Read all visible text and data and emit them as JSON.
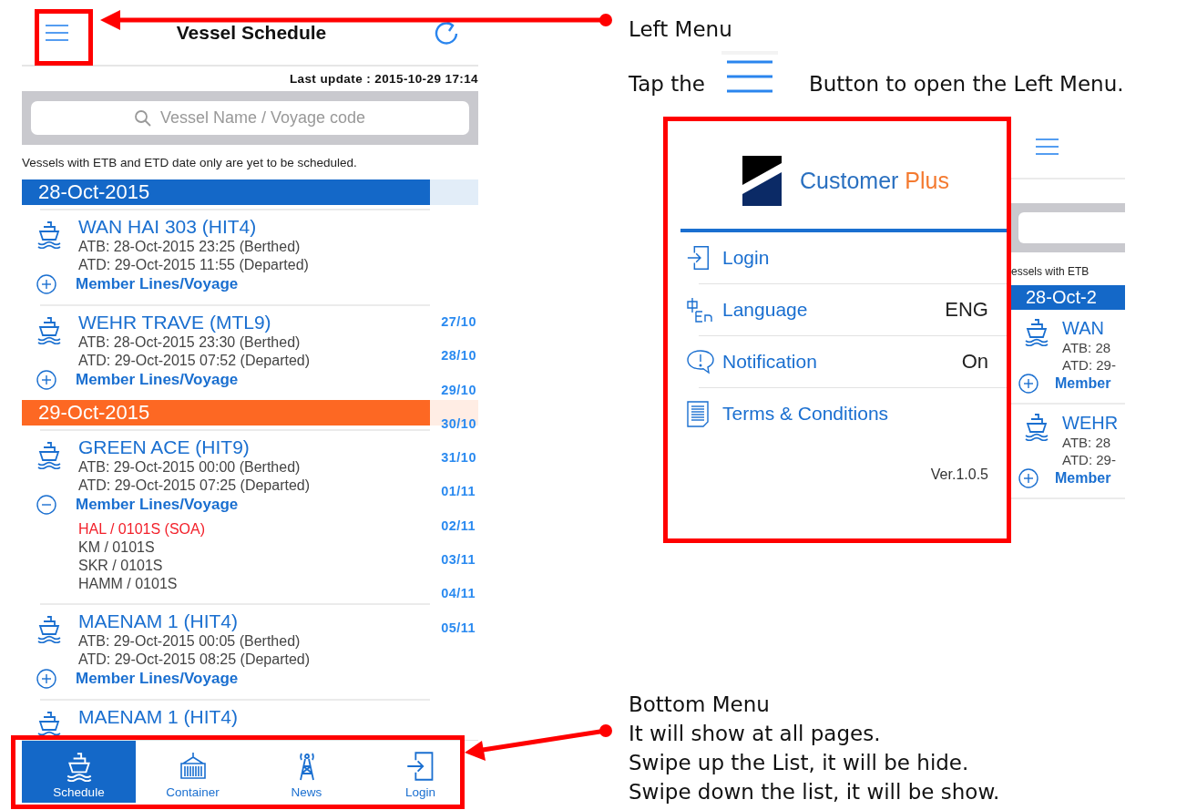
{
  "phone": {
    "title": "Vessel Schedule",
    "last_update": "Last update : 2015-10-29 17:14",
    "search": {
      "placeholder": "Vessel Name / Voyage code"
    },
    "notice": "Vessels with ETB and ETD date only are yet to be scheduled.",
    "groups": [
      {
        "date": "28-Oct-2015",
        "color": "#1468c8",
        "vessels": [
          {
            "name": "WAN HAI 303 (HIT4)",
            "atb": "ATB: 28-Oct-2015 23:25 (Berthed)",
            "atd": "ATD: 29-Oct-2015 11:55 (Departed)",
            "member_label": "Member Lines/Voyage",
            "expanded": false
          },
          {
            "name": "WEHR TRAVE (MTL9)",
            "atb": "ATB: 28-Oct-2015 23:30 (Berthed)",
            "atd": "ATD: 29-Oct-2015 07:52 (Departed)",
            "member_label": "Member Lines/Voyage",
            "expanded": false
          }
        ]
      },
      {
        "date": "29-Oct-2015",
        "color": "#fd6823",
        "vessels": [
          {
            "name": "GREEN ACE (HIT9)",
            "atb": "ATB: 29-Oct-2015 00:00 (Berthed)",
            "atd": "ATD: 29-Oct-2015 07:25 (Departed)",
            "member_label": "Member Lines/Voyage",
            "expanded": true,
            "members": [
              {
                "text": "HAL / 0101S (SOA)",
                "flagged": true
              },
              {
                "text": "KM / 0101S",
                "flagged": false
              },
              {
                "text": "SKR / 0101S",
                "flagged": false
              },
              {
                "text": "HAMM / 0101S",
                "flagged": false
              }
            ]
          },
          {
            "name": "MAENAM 1 (HIT4)",
            "atb": "ATB: 29-Oct-2015 00:05 (Berthed)",
            "atd": "ATD: 29-Oct-2015 08:25 (Departed)",
            "member_label": "Member Lines/Voyage",
            "expanded": false
          },
          {
            "name": "MAENAM 1 (HIT4)"
          }
        ]
      }
    ],
    "date_index": [
      "27/10",
      "28/10",
      "29/10",
      "30/10",
      "31/10",
      "01/11",
      "02/11",
      "03/11",
      "04/11",
      "05/11"
    ],
    "tabs": [
      {
        "kind": "ship",
        "label": "Schedule",
        "selected": true
      },
      {
        "kind": "container",
        "label": "Container",
        "selected": false
      },
      {
        "kind": "tower",
        "label": "News",
        "selected": false
      },
      {
        "kind": "login",
        "label": "Login",
        "selected": false
      }
    ]
  },
  "menu": {
    "logo_text": "Customer",
    "logo_accent": "Plus",
    "items": [
      {
        "kind": "login",
        "label": "Login"
      },
      {
        "kind": "language",
        "label": "Language",
        "value": "ENG"
      },
      {
        "kind": "notification",
        "label": "Notification",
        "value": "On"
      },
      {
        "kind": "terms",
        "label": "Terms & Conditions"
      }
    ],
    "version": "Ver.1.0.5",
    "preview": {
      "notice": "essels with ETB",
      "date": "28-Oct-2",
      "vessels": [
        {
          "name": "WAN",
          "atb": "ATB: 28",
          "atd": "ATD: 29-",
          "member_label": "Member"
        },
        {
          "name": "WEHR",
          "atb": "ATB: 28",
          "atd": "ATD: 29-",
          "member_label": "Member"
        }
      ]
    }
  },
  "annotations": {
    "left_menu": {
      "title": "Left Menu",
      "before": "Tap the",
      "after": "Button to open the Left Menu."
    },
    "bottom_menu": [
      "Bottom Menu",
      "It will show at all pages.",
      "Swipe up the List, it will be hide.",
      "Swipe down the list, it will be show."
    ]
  }
}
